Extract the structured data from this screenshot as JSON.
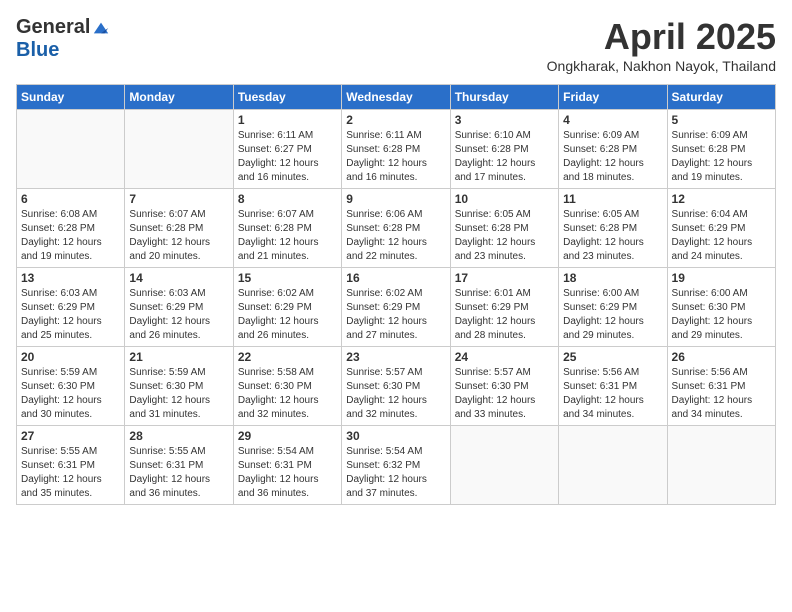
{
  "header": {
    "logo_general": "General",
    "logo_blue": "Blue",
    "title": "April 2025",
    "subtitle": "Ongkharak, Nakhon Nayok, Thailand"
  },
  "days_of_week": [
    "Sunday",
    "Monday",
    "Tuesday",
    "Wednesday",
    "Thursday",
    "Friday",
    "Saturday"
  ],
  "weeks": [
    [
      {
        "day": "",
        "info": ""
      },
      {
        "day": "",
        "info": ""
      },
      {
        "day": "1",
        "info": "Sunrise: 6:11 AM\nSunset: 6:27 PM\nDaylight: 12 hours and 16 minutes."
      },
      {
        "day": "2",
        "info": "Sunrise: 6:11 AM\nSunset: 6:28 PM\nDaylight: 12 hours and 16 minutes."
      },
      {
        "day": "3",
        "info": "Sunrise: 6:10 AM\nSunset: 6:28 PM\nDaylight: 12 hours and 17 minutes."
      },
      {
        "day": "4",
        "info": "Sunrise: 6:09 AM\nSunset: 6:28 PM\nDaylight: 12 hours and 18 minutes."
      },
      {
        "day": "5",
        "info": "Sunrise: 6:09 AM\nSunset: 6:28 PM\nDaylight: 12 hours and 19 minutes."
      }
    ],
    [
      {
        "day": "6",
        "info": "Sunrise: 6:08 AM\nSunset: 6:28 PM\nDaylight: 12 hours and 19 minutes."
      },
      {
        "day": "7",
        "info": "Sunrise: 6:07 AM\nSunset: 6:28 PM\nDaylight: 12 hours and 20 minutes."
      },
      {
        "day": "8",
        "info": "Sunrise: 6:07 AM\nSunset: 6:28 PM\nDaylight: 12 hours and 21 minutes."
      },
      {
        "day": "9",
        "info": "Sunrise: 6:06 AM\nSunset: 6:28 PM\nDaylight: 12 hours and 22 minutes."
      },
      {
        "day": "10",
        "info": "Sunrise: 6:05 AM\nSunset: 6:28 PM\nDaylight: 12 hours and 23 minutes."
      },
      {
        "day": "11",
        "info": "Sunrise: 6:05 AM\nSunset: 6:28 PM\nDaylight: 12 hours and 23 minutes."
      },
      {
        "day": "12",
        "info": "Sunrise: 6:04 AM\nSunset: 6:29 PM\nDaylight: 12 hours and 24 minutes."
      }
    ],
    [
      {
        "day": "13",
        "info": "Sunrise: 6:03 AM\nSunset: 6:29 PM\nDaylight: 12 hours and 25 minutes."
      },
      {
        "day": "14",
        "info": "Sunrise: 6:03 AM\nSunset: 6:29 PM\nDaylight: 12 hours and 26 minutes."
      },
      {
        "day": "15",
        "info": "Sunrise: 6:02 AM\nSunset: 6:29 PM\nDaylight: 12 hours and 26 minutes."
      },
      {
        "day": "16",
        "info": "Sunrise: 6:02 AM\nSunset: 6:29 PM\nDaylight: 12 hours and 27 minutes."
      },
      {
        "day": "17",
        "info": "Sunrise: 6:01 AM\nSunset: 6:29 PM\nDaylight: 12 hours and 28 minutes."
      },
      {
        "day": "18",
        "info": "Sunrise: 6:00 AM\nSunset: 6:29 PM\nDaylight: 12 hours and 29 minutes."
      },
      {
        "day": "19",
        "info": "Sunrise: 6:00 AM\nSunset: 6:30 PM\nDaylight: 12 hours and 29 minutes."
      }
    ],
    [
      {
        "day": "20",
        "info": "Sunrise: 5:59 AM\nSunset: 6:30 PM\nDaylight: 12 hours and 30 minutes."
      },
      {
        "day": "21",
        "info": "Sunrise: 5:59 AM\nSunset: 6:30 PM\nDaylight: 12 hours and 31 minutes."
      },
      {
        "day": "22",
        "info": "Sunrise: 5:58 AM\nSunset: 6:30 PM\nDaylight: 12 hours and 32 minutes."
      },
      {
        "day": "23",
        "info": "Sunrise: 5:57 AM\nSunset: 6:30 PM\nDaylight: 12 hours and 32 minutes."
      },
      {
        "day": "24",
        "info": "Sunrise: 5:57 AM\nSunset: 6:30 PM\nDaylight: 12 hours and 33 minutes."
      },
      {
        "day": "25",
        "info": "Sunrise: 5:56 AM\nSunset: 6:31 PM\nDaylight: 12 hours and 34 minutes."
      },
      {
        "day": "26",
        "info": "Sunrise: 5:56 AM\nSunset: 6:31 PM\nDaylight: 12 hours and 34 minutes."
      }
    ],
    [
      {
        "day": "27",
        "info": "Sunrise: 5:55 AM\nSunset: 6:31 PM\nDaylight: 12 hours and 35 minutes."
      },
      {
        "day": "28",
        "info": "Sunrise: 5:55 AM\nSunset: 6:31 PM\nDaylight: 12 hours and 36 minutes."
      },
      {
        "day": "29",
        "info": "Sunrise: 5:54 AM\nSunset: 6:31 PM\nDaylight: 12 hours and 36 minutes."
      },
      {
        "day": "30",
        "info": "Sunrise: 5:54 AM\nSunset: 6:32 PM\nDaylight: 12 hours and 37 minutes."
      },
      {
        "day": "",
        "info": ""
      },
      {
        "day": "",
        "info": ""
      },
      {
        "day": "",
        "info": ""
      }
    ]
  ]
}
